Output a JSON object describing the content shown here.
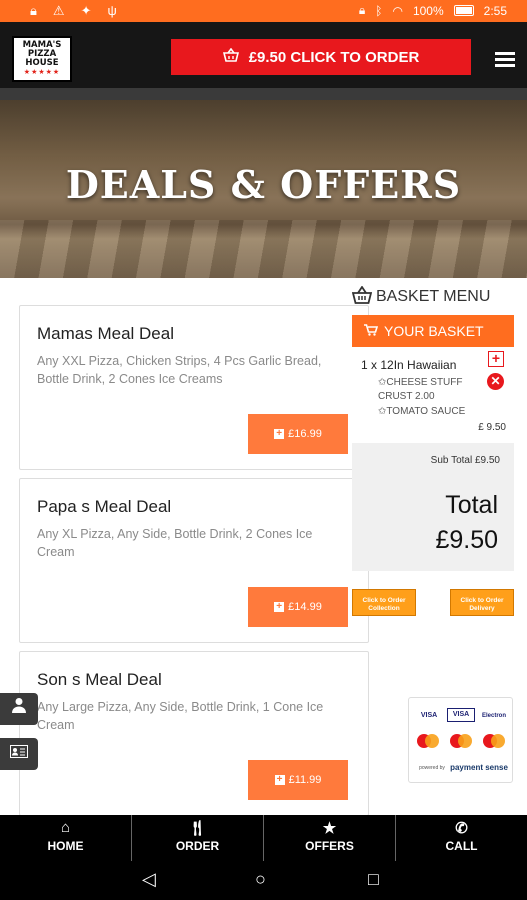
{
  "status_bar": {
    "battery": "100%",
    "time": "2:55"
  },
  "header": {
    "logo_line1": "MAMA'S",
    "logo_line2": "PIZZA",
    "logo_line3": "HOUSE",
    "logo_stars": "★★★★★",
    "order_button_label": "£9.50 CLICK TO ORDER"
  },
  "hero": {
    "title": "DEALS & OFFERS"
  },
  "deals": [
    {
      "name": "Mamas Meal Deal",
      "description": "Any XXL Pizza, Chicken Strips, 4 Pcs Garlic Bread, Bottle Drink, 2 Cones Ice Creams",
      "price": "£16.99"
    },
    {
      "name": "Papa s Meal Deal",
      "description": "Any XL Pizza, Any Side, Bottle Drink, 2 Cones Ice Cream",
      "price": "£14.99"
    },
    {
      "name": "Son s Meal Deal",
      "description": "Any Large Pizza, Any Side, Bottle Drink, 1 Cone Ice Cream",
      "price": "£11.99"
    }
  ],
  "basket": {
    "menu_label": "BASKET MENU",
    "your_basket_label": "YOUR BASKET",
    "item_name": "1 x 12In Hawaiian",
    "item_option1_line1": "✩CHEESE STUFF",
    "item_option1_line2": "CRUST 2.00",
    "item_option2": "✩TOMATO SAUCE",
    "item_price": "£ 9.50",
    "subtotal": "Sub Total £9.50",
    "total_label": "Total",
    "total_value": "£9.50",
    "collection_line1": "Click to Order",
    "collection_line2": "Collection",
    "delivery_line1": "Click to Order",
    "delivery_line2": "Delivery"
  },
  "payment": {
    "visa": "VISA",
    "visa_debit": "VISA",
    "visa_electron": "Electron",
    "powered_by": "powered by",
    "payment_sense": "payment sense"
  },
  "bottom_nav": [
    {
      "label": "HOME",
      "icon": "home-icon"
    },
    {
      "label": "ORDER",
      "icon": "cutlery-icon"
    },
    {
      "label": "OFFERS",
      "icon": "star-icon"
    },
    {
      "label": "CALL",
      "icon": "phone-icon"
    }
  ]
}
